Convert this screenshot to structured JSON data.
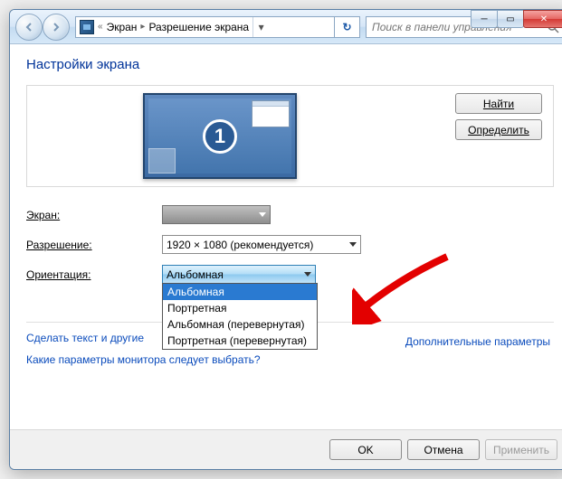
{
  "titlebar": {
    "breadcrumb1": "Экран",
    "breadcrumb2": "Разрешение экрана",
    "search_placeholder": "Поиск в панели управления"
  },
  "page": {
    "title": "Настройки экрана"
  },
  "preview": {
    "monitor_number": "1",
    "find_btn": "Найти",
    "detect_btn": "Определить"
  },
  "form": {
    "screen_label": "Экран:",
    "resolution_label": "Разрешение:",
    "resolution_value": "1920 × 1080 (рекомендуется)",
    "orientation_label": "Ориентация:",
    "orientation_value": "Альбомная",
    "orientation_options": [
      "Альбомная",
      "Портретная",
      "Альбомная (перевернутая)",
      "Портретная (перевернутая)"
    ]
  },
  "links": {
    "advanced": "Дополнительные параметры",
    "text_size": "Сделать текст и другие",
    "help": "Какие параметры монитора следует выбрать?"
  },
  "buttons": {
    "ok": "OK",
    "cancel": "Отмена",
    "apply": "Применить"
  }
}
